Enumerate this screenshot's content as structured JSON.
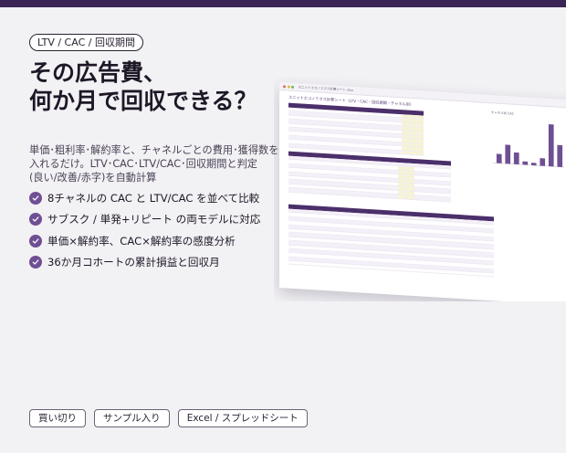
{
  "tag_label": "LTV / CAC / 回収期間",
  "headline": {
    "line1": "その広告費、",
    "line2": "何か月で回収できる？"
  },
  "description": {
    "line1": "単価･粗利率･解約率と、チャネルごとの費用･獲得数を",
    "line2": "入れるだけ。LTV･CAC･LTV/CAC･回収期間と判定",
    "line3": "(良い/改善/赤字)を自動計算"
  },
  "features": [
    "8チャネルの CAC と LTV/CAC を並べて比較",
    "サブスク / 単発+リピート の両モデルに対応",
    "単価×解約率、CAC×解約率の感度分析",
    "36か月コホートの累計損益と回収月"
  ],
  "badges": [
    "買い切り",
    "サンプル入り",
    "Excel / スプレッドシート"
  ],
  "sheet": {
    "filename": "ユニットエコノミクス計算シート.xlsx",
    "heading": "ユニットエコノミクス計算シート（LTV・CAC・回収期間・チャネル別）",
    "chart_title": "チャネル別 CAC",
    "chart_bar_heights": [
      0.22,
      0.45,
      0.28,
      0.08,
      0.06,
      0.18,
      1.0,
      0.52
    ]
  },
  "colors": {
    "accent": "#6f4f93",
    "dark_bar": "#3b2456",
    "background": "#f2f1f4"
  }
}
